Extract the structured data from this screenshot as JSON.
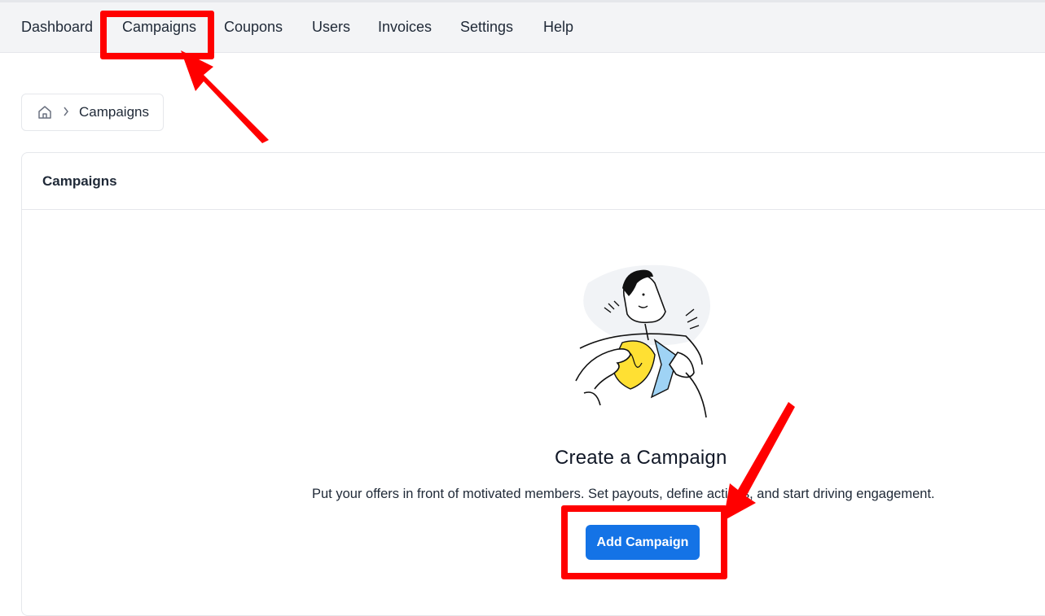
{
  "nav": {
    "items": [
      {
        "label": "Dashboard"
      },
      {
        "label": "Campaigns"
      },
      {
        "label": "Coupons"
      },
      {
        "label": "Users"
      },
      {
        "label": "Invoices"
      },
      {
        "label": "Settings"
      },
      {
        "label": "Help"
      }
    ]
  },
  "breadcrumb": {
    "home_icon": "home-icon",
    "separator_icon": "chevron-right-icon",
    "current": "Campaigns"
  },
  "card": {
    "title": "Campaigns"
  },
  "empty_state": {
    "illustration": "person-opening-shirt-illustration",
    "title": "Create a Campaign",
    "description": "Put your offers in front of motivated members. Set payouts, define actions, and start driving engagement.",
    "button_label": "Add Campaign"
  },
  "colors": {
    "accent": "#1473e6",
    "annotation": "#ff0000",
    "nav_bg": "#f3f4f6"
  }
}
